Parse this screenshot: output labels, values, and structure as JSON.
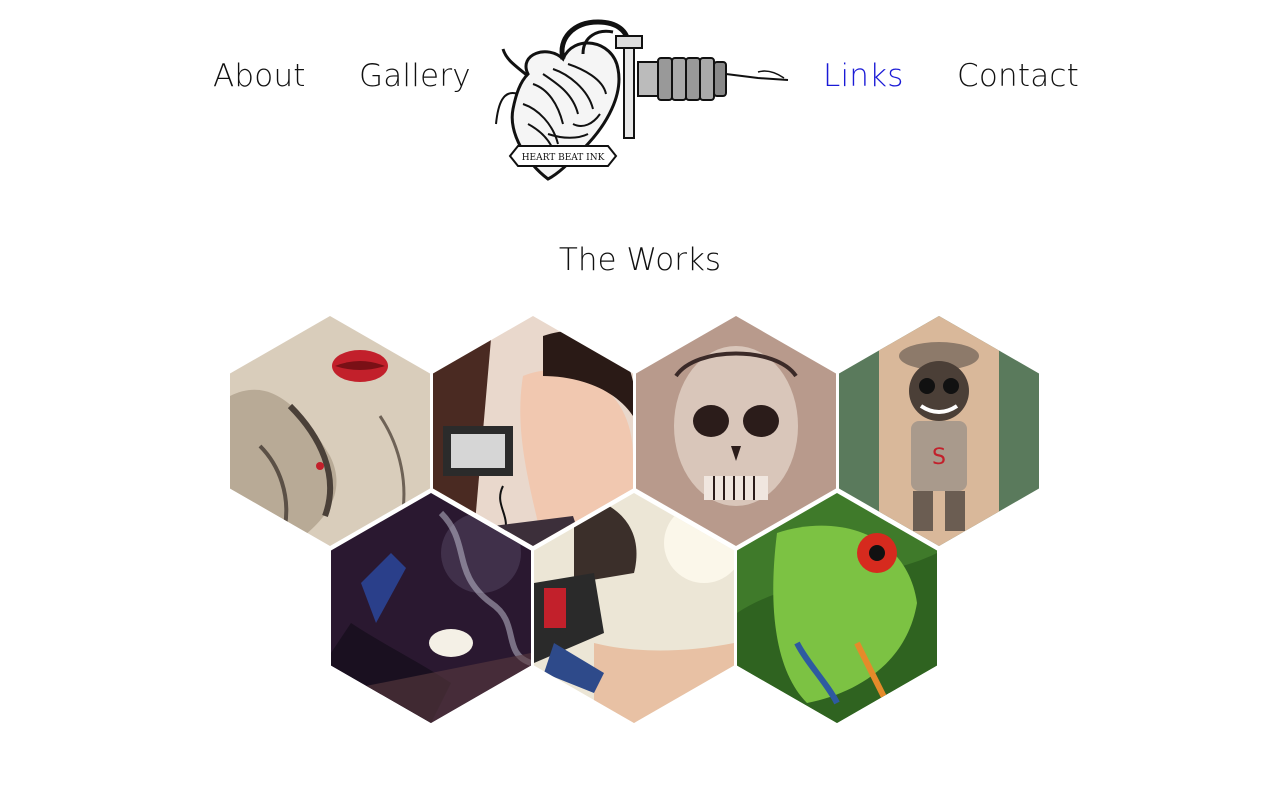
{
  "nav": {
    "about": "About",
    "gallery": "Gallery",
    "links": "Links",
    "contact": "Contact",
    "active_color": "#1a1ad6",
    "text_color": "#111111"
  },
  "logo": {
    "icon": "heart-tattoo-machine-logo",
    "banner_text": "HEART BEAT INK"
  },
  "section": {
    "title": "The Works"
  },
  "gallery": {
    "items": [
      {
        "icon": "lips-hand-tattoo-image"
      },
      {
        "icon": "tattoo-artist-woman-image"
      },
      {
        "icon": "skull-tattoo-image"
      },
      {
        "icon": "cartoon-monkey-tattoo-image"
      },
      {
        "icon": "tattoo-machine-smoke-image"
      },
      {
        "icon": "artist-tattooing-image"
      },
      {
        "icon": "tree-frog-image"
      }
    ]
  }
}
